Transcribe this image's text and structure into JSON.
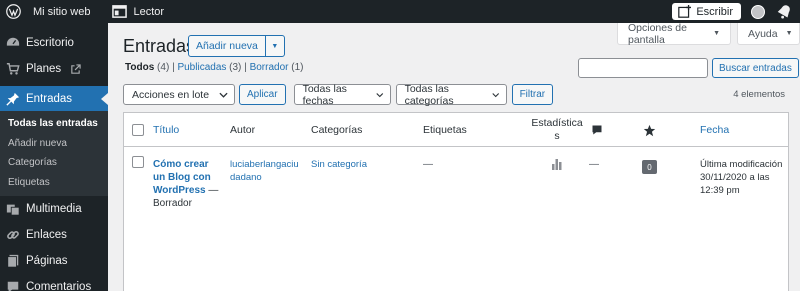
{
  "topbar": {
    "site_name": "Mi sitio web",
    "reader": "Lector",
    "write": "Escribir"
  },
  "sidebar": {
    "items": [
      {
        "label": "Escritorio",
        "icon": "dashboard-icon"
      },
      {
        "label": "Planes",
        "icon": "cart-icon"
      },
      {
        "label": "Entradas",
        "icon": "pin-icon"
      }
    ],
    "submenu": [
      "Todas las entradas",
      "Añadir nueva",
      "Categorías",
      "Etiquetas"
    ],
    "items_after": [
      {
        "label": "Multimedia",
        "icon": "media-icon"
      },
      {
        "label": "Enlaces",
        "icon": "link-icon"
      },
      {
        "label": "Páginas",
        "icon": "pages-icon"
      },
      {
        "label": "Comentarios",
        "icon": "comment-icon"
      }
    ]
  },
  "main": {
    "screen_options": "Opciones de pantalla",
    "help": "Ayuda",
    "title": "Entradas",
    "add_new": "Añadir nueva",
    "filters": {
      "all": "Todos",
      "all_count": "(4)",
      "published": "Publicadas",
      "published_count": "(3)",
      "draft": "Borrador",
      "draft_count": "(1)"
    },
    "search_button": "Buscar entradas",
    "bulk_actions": "Acciones en lote",
    "apply": "Aplicar",
    "all_dates": "Todas las fechas",
    "all_categories": "Todas las categorías",
    "filter": "Filtrar",
    "item_count": "4 elementos"
  },
  "table": {
    "headers": {
      "title": "Título",
      "author": "Autor",
      "categories": "Categorías",
      "tags": "Etiquetas",
      "stats_line1": "Estadística",
      "stats_line2": "s",
      "date": "Fecha"
    },
    "rows": [
      {
        "title_lines": [
          "Cómo crear",
          "un Blog con",
          "WordPress"
        ],
        "title_suffix": " —",
        "state": "Borrador",
        "author_lines": [
          "luciaberlangaciu",
          "dadano"
        ],
        "category": "Sin categoría",
        "tags": "—",
        "comments_dash": "—",
        "likes": "0",
        "date_lines": [
          "Última modificación",
          "30/11/2020 a las",
          "12:39 pm"
        ]
      }
    ]
  },
  "colors": {
    "admin_bar": "#1d2327",
    "accent": "#2271b1",
    "background": "#f0f0f1"
  }
}
